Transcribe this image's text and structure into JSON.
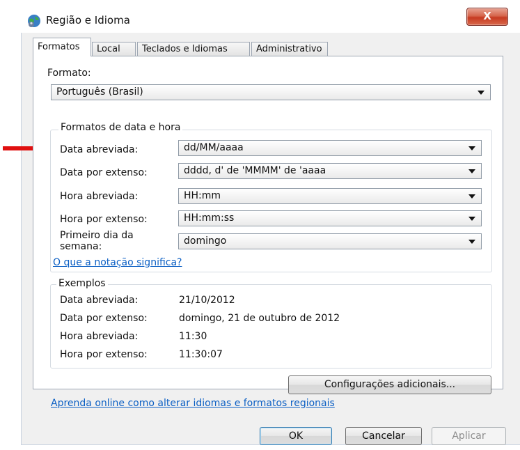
{
  "window": {
    "title": "Região e Idioma",
    "close_label": "X"
  },
  "tabs": [
    {
      "label": "Formatos"
    },
    {
      "label": "Local"
    },
    {
      "label": "Teclados e Idiomas"
    },
    {
      "label": "Administrativo"
    }
  ],
  "formats": {
    "format_label": "Formato:",
    "format_value": "Português (Brasil)",
    "datetime_group_title": "Formatos de data e hora",
    "rows": [
      {
        "label": "Data abreviada:",
        "value": "dd/MM/aaaa"
      },
      {
        "label": "Data por extenso:",
        "value": "dddd, d' de 'MMMM' de 'aaaa"
      },
      {
        "label": "Hora abreviada:",
        "value": "HH:mm"
      },
      {
        "label": "Hora por extenso:",
        "value": "HH:mm:ss"
      }
    ],
    "first_day_label_line1": "Primeiro dia da",
    "first_day_label_line2": "semana:",
    "first_day_value": "domingo",
    "notation_link": "O que a notação significa?"
  },
  "examples": {
    "title": "Exemplos",
    "rows": [
      {
        "label": "Data abreviada:",
        "value": "21/10/2012"
      },
      {
        "label": "Data por extenso:",
        "value": "domingo, 21 de outubro de 2012"
      },
      {
        "label": "Hora abreviada:",
        "value": "11:30"
      },
      {
        "label": "Hora por extenso:",
        "value": "11:30:07"
      }
    ]
  },
  "buttons": {
    "additional_settings": "Configurações adicionais...",
    "ok": "OK",
    "cancel": "Cancelar",
    "apply": "Aplicar"
  },
  "learn_online_link": "Aprenda online como alterar idiomas e formatos regionais",
  "annotation": {
    "arrow_color": "#e01010"
  }
}
